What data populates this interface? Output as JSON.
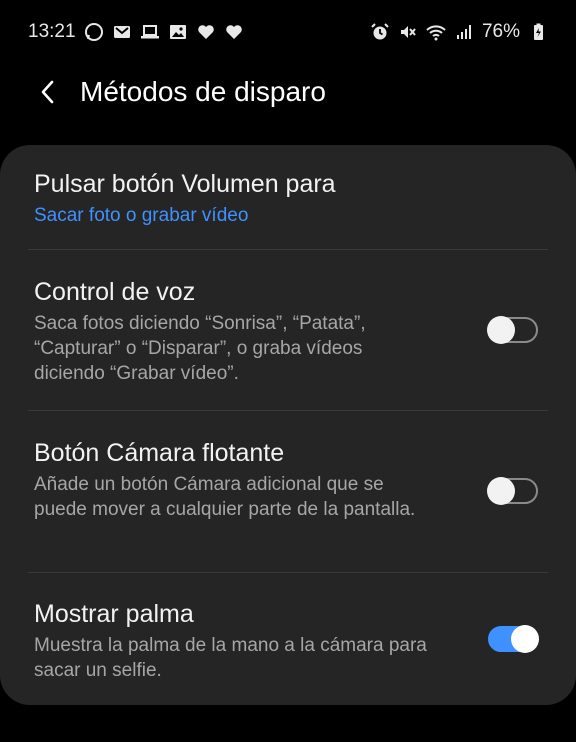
{
  "status_bar": {
    "time": "13:21",
    "battery": "76%",
    "left_icons": [
      "whatsapp-icon",
      "gmail-icon",
      "laptop-icon",
      "image-icon",
      "heart-icon",
      "heart-icon"
    ],
    "right_icons": [
      "alarm-icon",
      "mute-icon",
      "wifi-icon",
      "signal-icon",
      "battery-icon"
    ]
  },
  "header": {
    "title": "Métodos de disparo"
  },
  "colors": {
    "accent": "#3e91ff",
    "card": "#252525",
    "background": "#000000"
  },
  "settings": {
    "volume": {
      "title": "Pulsar botón Volumen para",
      "value": "Sacar foto o grabar vídeo"
    },
    "voice": {
      "title": "Control de voz",
      "description": "Saca fotos diciendo “Sonrisa”, “Patata”, “Capturar” o “Disparar”, o graba vídeos diciendo “Grabar vídeo”.",
      "enabled": false
    },
    "floating": {
      "title": "Botón Cámara flotante",
      "description": "Añade un botón Cámara adicional que se puede mover a cualquier parte de la pantalla.",
      "enabled": false
    },
    "palm": {
      "title": "Mostrar palma",
      "description": "Muestra la palma de la mano a la cámara para sacar un selfie.",
      "enabled": true
    }
  }
}
